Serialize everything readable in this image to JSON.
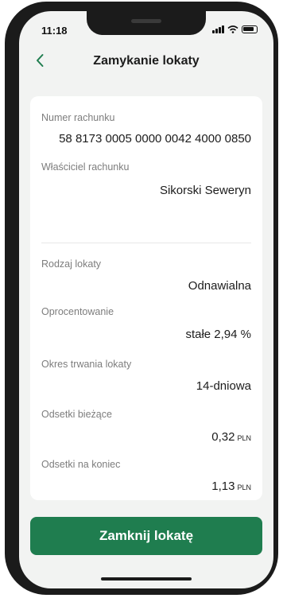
{
  "status_bar": {
    "time": "11:18"
  },
  "header": {
    "title": "Zamykanie lokaty",
    "back_icon": "chevron-left-icon"
  },
  "details": {
    "account_number_label": "Numer rachunku",
    "account_number": "58 8173 0005 0000 0042 4000 0850",
    "owner_label": "Właściciel rachunku",
    "owner": "Sikorski Seweryn",
    "deposit_type_label": "Rodzaj lokaty",
    "deposit_type": "Odnawialna",
    "interest_label": "Oprocentowanie",
    "interest": "stałe 2,94 %",
    "term_label": "Okres trwania lokaty",
    "term": "14-dniowa",
    "current_interest_label": "Odsetki bieżące",
    "current_interest_amount": "0,32",
    "current_interest_currency": "PLN",
    "final_interest_label": "Odsetki na koniec",
    "final_interest_amount": "1,13",
    "final_interest_currency": "PLN"
  },
  "actions": {
    "close_deposit_label": "Zamknij lokatę"
  },
  "colors": {
    "accent": "#1f7d4f",
    "background": "#f2f3f2",
    "card": "#ffffff"
  }
}
